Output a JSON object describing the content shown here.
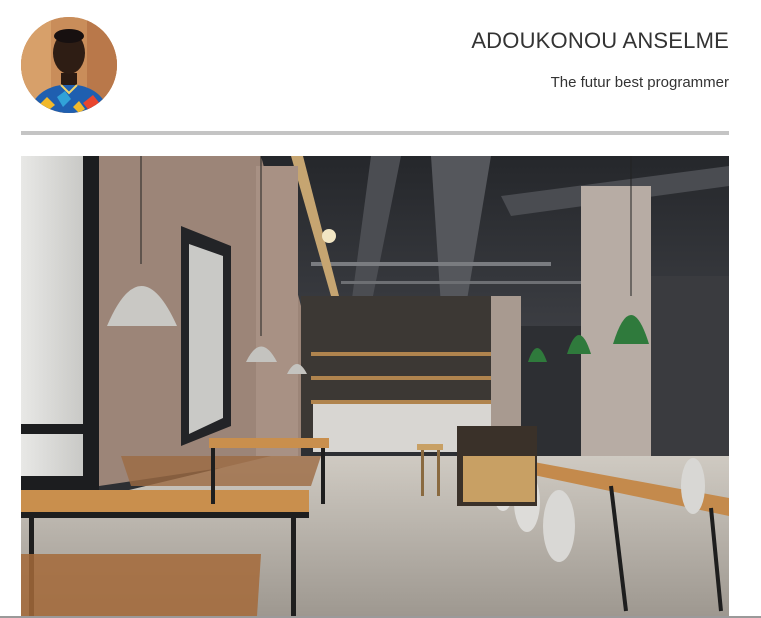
{
  "header": {
    "name": "ADOUKONOU ANSELME",
    "tagline": "The futur best programmer",
    "avatar_icon": "profile-photo"
  },
  "hero": {
    "image_icon": "restaurant-interior-photo"
  },
  "colors": {
    "text": "#333333",
    "divider": "#c4c4c4",
    "background": "#ffffff"
  }
}
